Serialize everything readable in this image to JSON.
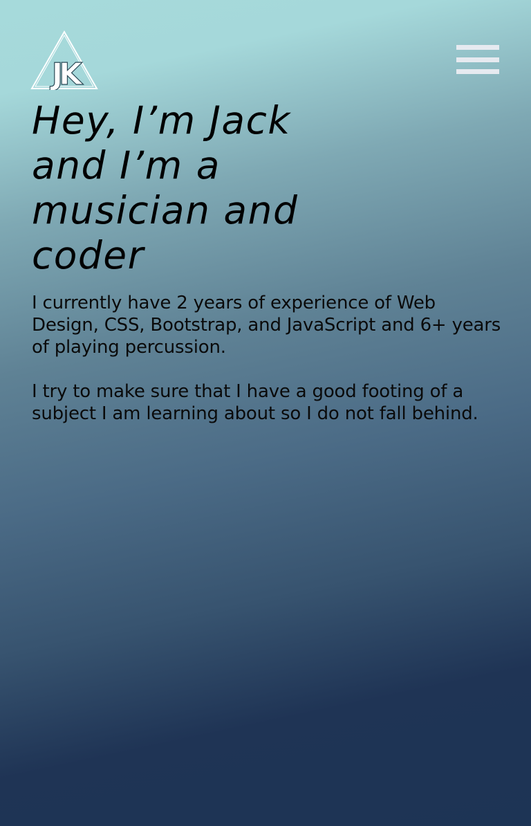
{
  "header": {
    "logo_text": "JK",
    "logo_icon": "triangle-jk-logo-icon",
    "menu_icon": "hamburger-menu-icon"
  },
  "hero": {
    "headline": "Hey, I’m Jack and I’m a musician and coder",
    "paragraphs": [
      "I currently have 2 years of experience of Web Design, CSS, Bootstrap, and JavaScript and 6+ years of playing percussion.",
      "I try to make sure that I have a good footing of a subject I am learning about so I do not fall behind."
    ]
  },
  "colors": {
    "gradient_top": "#a6dadb",
    "gradient_bottom": "#1d3455",
    "menu_bars": "#e6eaf0",
    "text": "#000000"
  }
}
